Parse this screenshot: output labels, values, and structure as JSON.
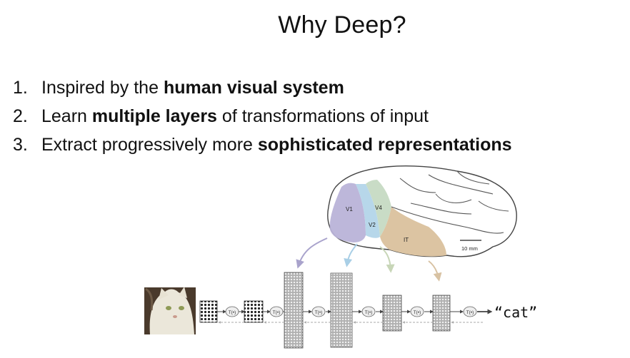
{
  "slide": {
    "title": "Why Deep?",
    "bullets": [
      {
        "number": "1.",
        "parts": [
          {
            "text": "Inspired by the ",
            "bold": false
          },
          {
            "text": "human visual system",
            "bold": true
          }
        ]
      },
      {
        "number": "2.",
        "parts": [
          {
            "text": "Learn ",
            "bold": false
          },
          {
            "text": "multiple layers",
            "bold": true
          },
          {
            "text": " of transformations of input",
            "bold": false
          }
        ]
      },
      {
        "number": "3.",
        "parts": [
          {
            "text": "Extract progressively more ",
            "bold": false
          },
          {
            "text": "sophisticated representations",
            "bold": true
          }
        ]
      }
    ]
  },
  "figure": {
    "brain_labels": {
      "v1": "V1",
      "v2": "V2",
      "v4": "V4",
      "it": "IT"
    },
    "scale_bar": "10 mm",
    "transform_label": "T(•)",
    "output_label": "“cat”",
    "colors": {
      "v1": "#b9b3d8",
      "v2": "#b7d7ea",
      "v4": "#c9dcc6",
      "it": "#dcc4a2",
      "arrow_v1": "#a9a3cc",
      "arrow_v2": "#a9cfe6",
      "arrow_v4": "#c8d6b8",
      "arrow_it": "#d8c2a3"
    }
  }
}
